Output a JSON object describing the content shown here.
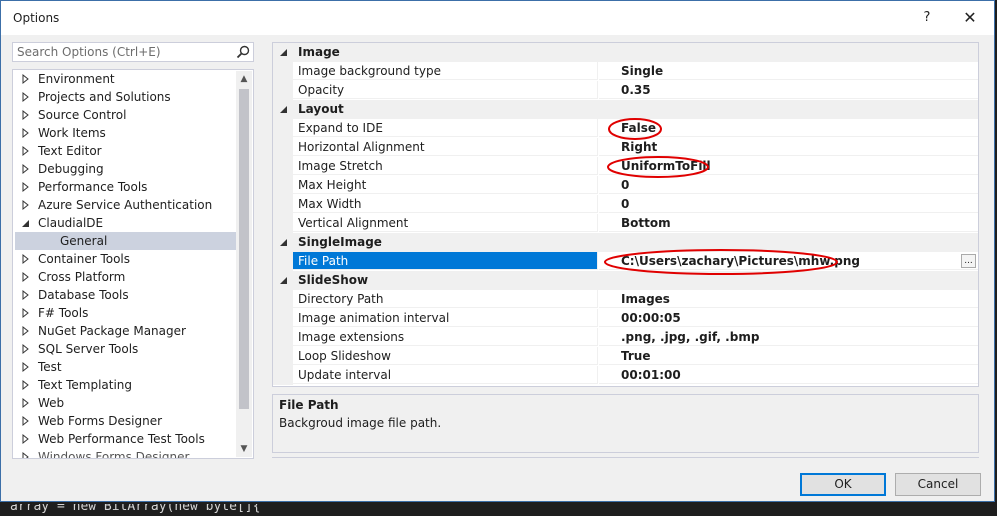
{
  "window": {
    "title": "Options",
    "help_label": "?",
    "close_label": "✕"
  },
  "search": {
    "placeholder": "Search Options (Ctrl+E)"
  },
  "tree": {
    "items": [
      {
        "label": "Environment",
        "expanded": false
      },
      {
        "label": "Projects and Solutions",
        "expanded": false
      },
      {
        "label": "Source Control",
        "expanded": false
      },
      {
        "label": "Work Items",
        "expanded": false
      },
      {
        "label": "Text Editor",
        "expanded": false
      },
      {
        "label": "Debugging",
        "expanded": false
      },
      {
        "label": "Performance Tools",
        "expanded": false
      },
      {
        "label": "Azure Service Authentication",
        "expanded": false
      },
      {
        "label": "ClaudialDE",
        "expanded": true
      },
      {
        "label": "General",
        "child": true,
        "selected": true
      },
      {
        "label": "Container Tools",
        "expanded": false
      },
      {
        "label": "Cross Platform",
        "expanded": false
      },
      {
        "label": "Database Tools",
        "expanded": false
      },
      {
        "label": "F# Tools",
        "expanded": false
      },
      {
        "label": "NuGet Package Manager",
        "expanded": false
      },
      {
        "label": "SQL Server Tools",
        "expanded": false
      },
      {
        "label": "Test",
        "expanded": false
      },
      {
        "label": "Text Templating",
        "expanded": false
      },
      {
        "label": "Web",
        "expanded": false
      },
      {
        "label": "Web Forms Designer",
        "expanded": false
      },
      {
        "label": "Web Performance Test Tools",
        "expanded": false
      },
      {
        "label": "Windows Forms Designer",
        "expanded": false
      }
    ]
  },
  "properties": {
    "rows": [
      {
        "type": "category",
        "label": "Image"
      },
      {
        "type": "prop",
        "name": "Image background type",
        "value": "Single"
      },
      {
        "type": "prop",
        "name": "Opacity",
        "value": "0.35"
      },
      {
        "type": "category",
        "label": "Layout"
      },
      {
        "type": "prop",
        "name": "Expand to IDE",
        "value": "False",
        "circled": true
      },
      {
        "type": "prop",
        "name": "Horizontal Alignment",
        "value": "Right"
      },
      {
        "type": "prop",
        "name": "Image Stretch",
        "value": "UniformToFill",
        "circled": true
      },
      {
        "type": "prop",
        "name": "Max Height",
        "value": "0"
      },
      {
        "type": "prop",
        "name": "Max Width",
        "value": "0"
      },
      {
        "type": "prop",
        "name": "Vertical Alignment",
        "value": "Bottom"
      },
      {
        "type": "category",
        "label": "SingleImage"
      },
      {
        "type": "prop",
        "name": "File Path",
        "value": "C:\\Users\\zachary\\Pictures\\mhw.png",
        "selected": true,
        "circled": true,
        "ellipsis": "..."
      },
      {
        "type": "category",
        "label": "SlideShow"
      },
      {
        "type": "prop",
        "name": "Directory Path",
        "value": "Images"
      },
      {
        "type": "prop",
        "name": "Image animation interval",
        "value": "00:00:05"
      },
      {
        "type": "prop",
        "name": "Image extensions",
        "value": ".png, .jpg, .gif, .bmp"
      },
      {
        "type": "prop",
        "name": "Loop Slideshow",
        "value": "True"
      },
      {
        "type": "prop",
        "name": "Update interval",
        "value": "00:01:00"
      }
    ]
  },
  "description": {
    "title": "File Path",
    "text": "Backgroud image file path."
  },
  "buttons": {
    "ok": "OK",
    "cancel": "Cancel"
  },
  "background_code": "array = new BitArray(new byte[]{",
  "colors": {
    "selection": "#0078d7",
    "tree_selection": "#ccd2df",
    "annotation": "#e00000"
  }
}
